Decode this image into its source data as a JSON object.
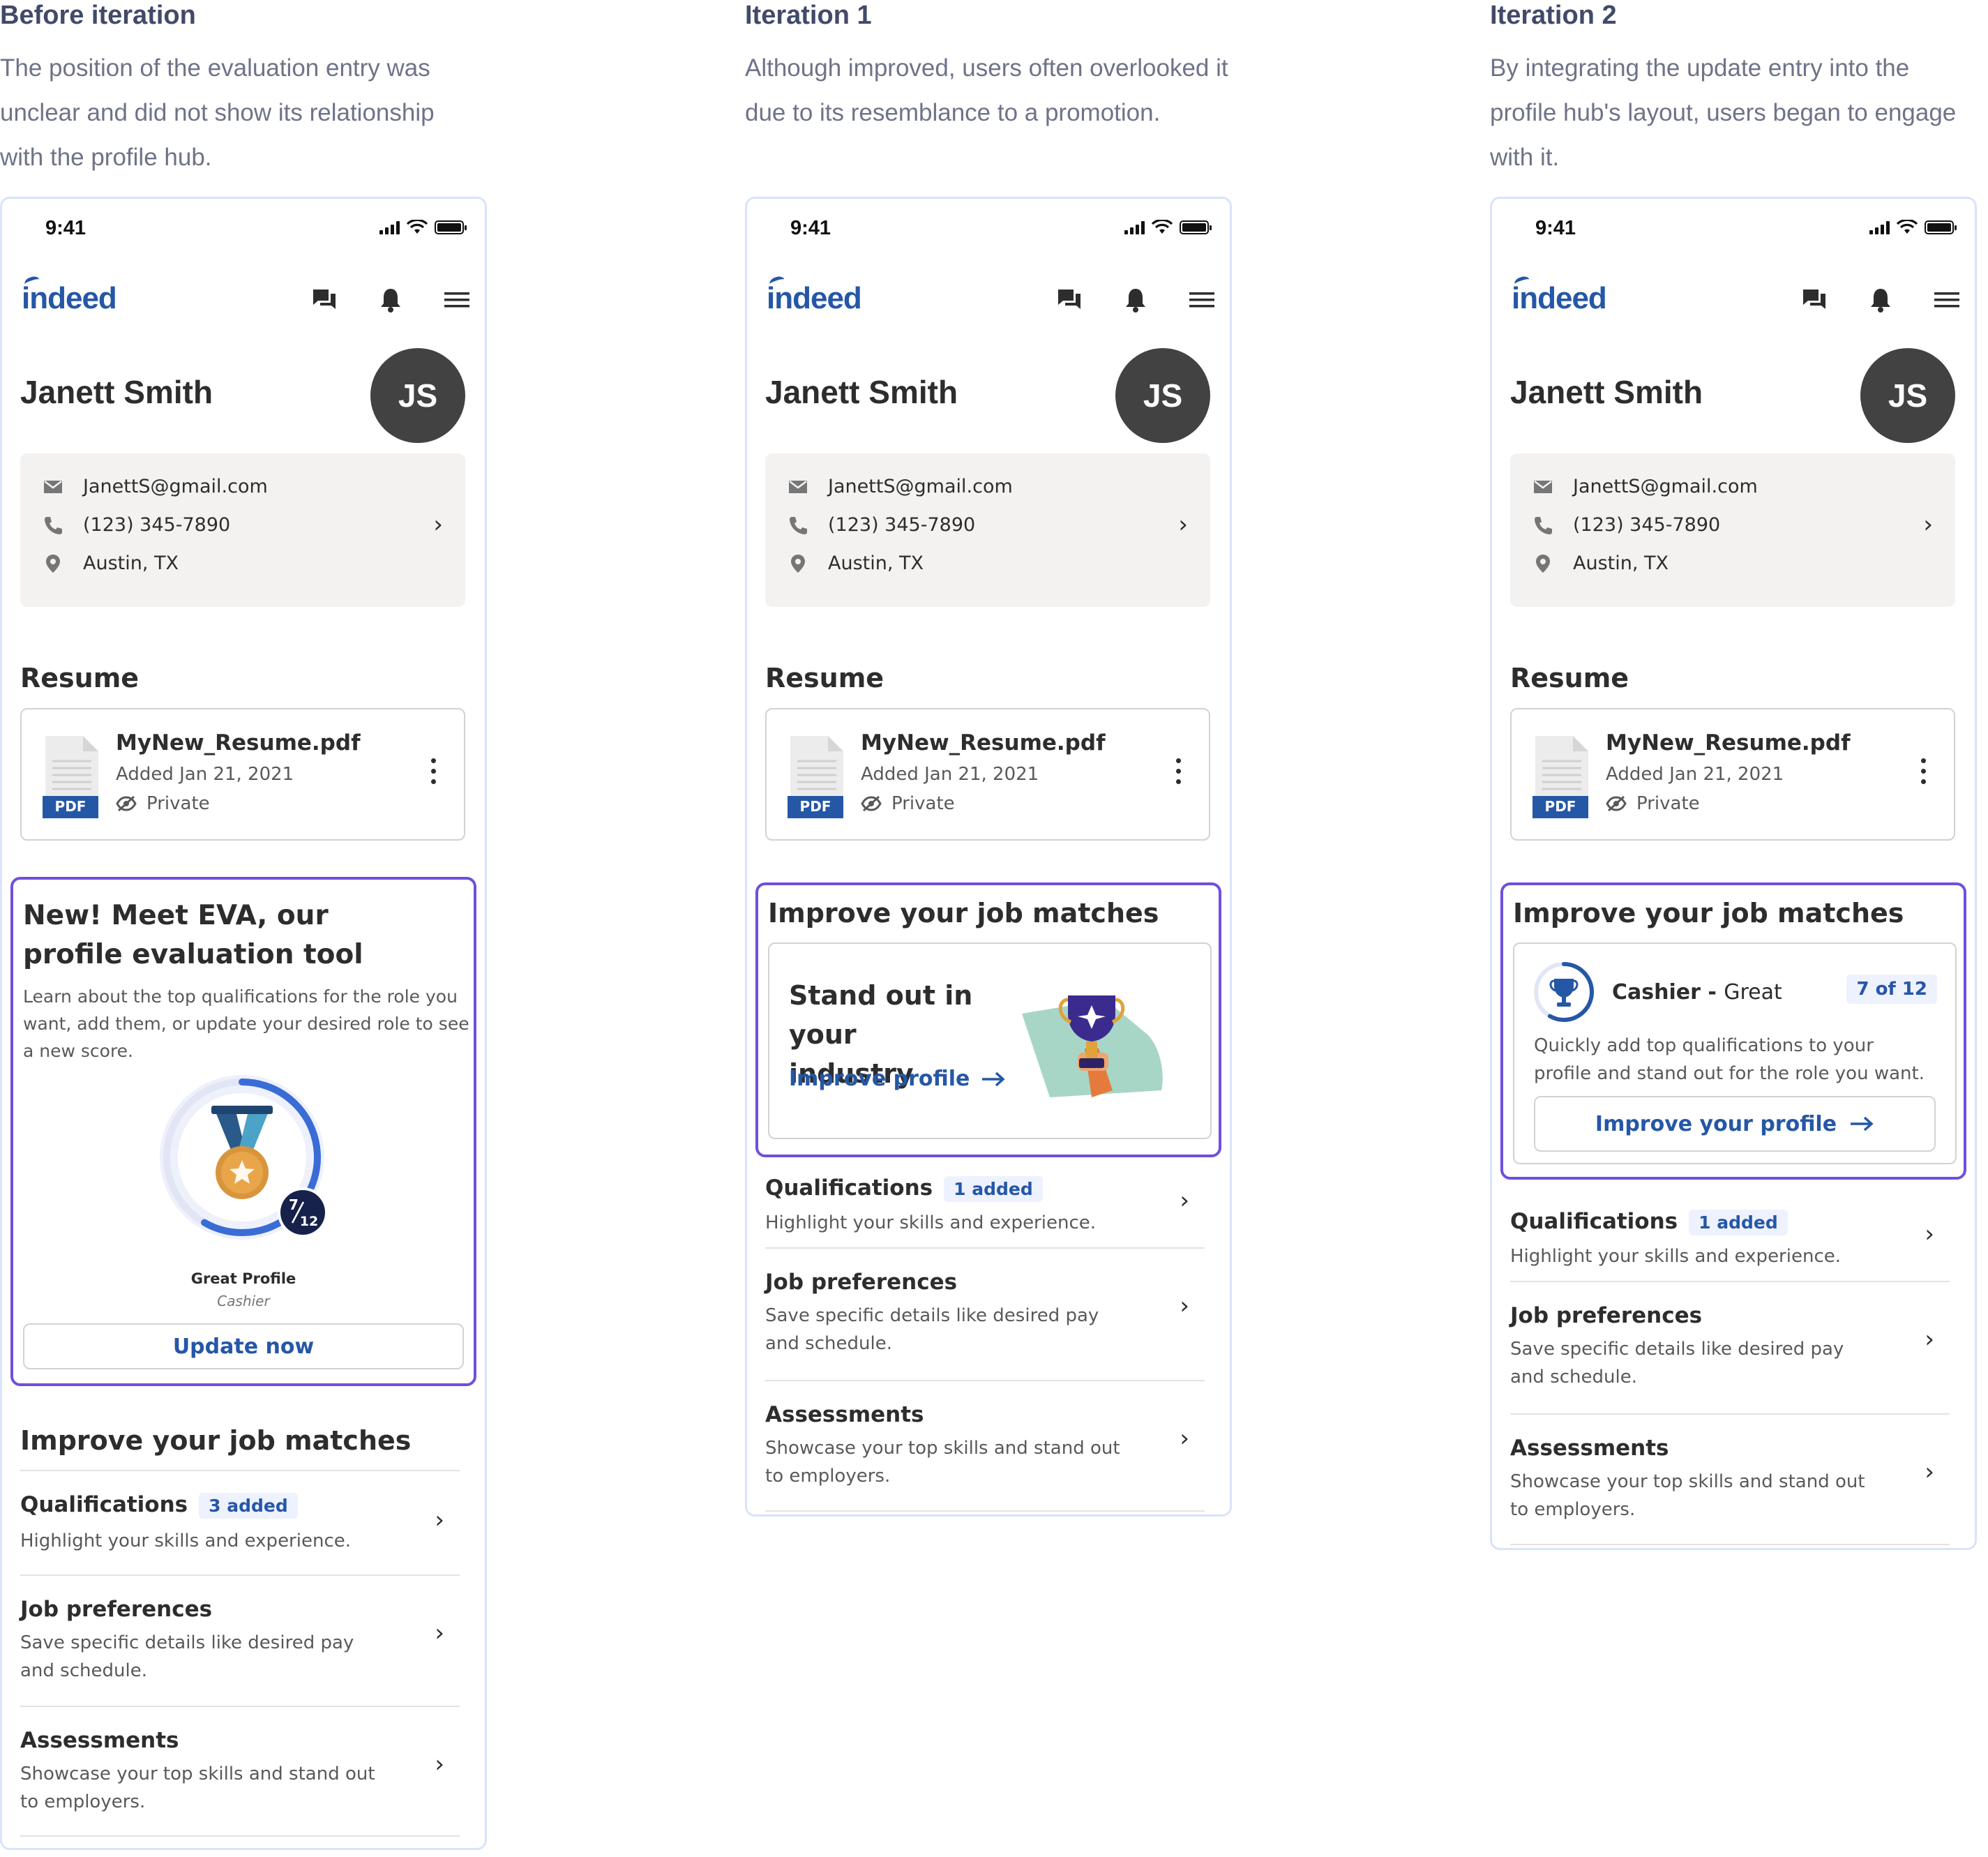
{
  "columns": [
    {
      "title": "Before iteration",
      "description": "The position of the evaluation entry was unclear and did not show its relationship with the profile hub."
    },
    {
      "title": "Iteration 1",
      "description": "Although improved, users often overlooked it due to its resemblance to a promotion."
    },
    {
      "title": "Iteration 2",
      "description": "By integrating the update entry into the profile hub's layout, users began to engage with it."
    }
  ],
  "phone": {
    "time": "9:41",
    "logo": "indeed",
    "nav_icons": [
      "messages-icon",
      "bell-icon",
      "menu-icon"
    ],
    "name": "Janett Smith",
    "initials": "JS",
    "email": "JanettS@gmail.com",
    "phone_number": "(123) 345-7890",
    "location": "Austin, TX",
    "resume_heading": "Resume",
    "resume_file": "MyNew_Resume.pdf",
    "resume_date": "Added Jan 21, 2021",
    "resume_privacy": "Private",
    "pdf_tag": "PDF"
  },
  "before": {
    "eva_title": "New! Meet EVA, our profile evaluation tool",
    "eva_desc": "Learn about the top qualifications for the role you want, add them, or update your desired role to see a new score.",
    "score_label": "Great Profile",
    "score_role": "Cashier",
    "score_num": "7",
    "score_den": "12",
    "score_fraction": 0.583,
    "update_button": "Update now",
    "section_title": "Improve your job matches",
    "qual_badge": "3 added"
  },
  "iter1": {
    "section_title": "Improve your job matches",
    "card_title": "Stand out in your industry",
    "card_link": "Improve profile",
    "qual_badge": "1 added"
  },
  "iter2": {
    "section_title": "Improve your job matches",
    "role": "Cashier",
    "role_sep": " - ",
    "rating": "Great",
    "count_badge": "7 of 12",
    "score_fraction": 0.583,
    "card_desc": "Quickly add top qualifications to your profile and stand out for the role you want.",
    "button": "Improve your profile",
    "qual_badge": "1 added"
  },
  "list": {
    "qualifications_title": "Qualifications",
    "qualifications_desc": "Highlight your skills and experience.",
    "preferences_title": "Job preferences",
    "preferences_desc": "Save specific details like desired pay and schedule.",
    "assessments_title": "Assessments",
    "assessments_desc": "Showcase your top skills and stand out to employers."
  },
  "colors": {
    "accent": "#2557a7",
    "highlight": "#6f4fdc",
    "heading": "#424a6a",
    "muted": "#6f7388"
  }
}
